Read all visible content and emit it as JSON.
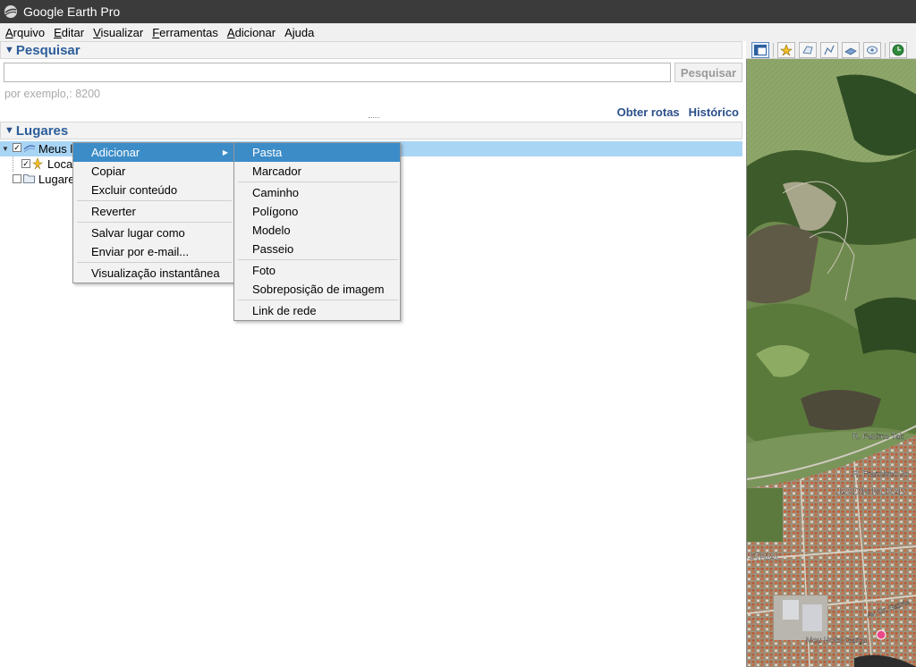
{
  "window": {
    "title": "Google Earth Pro"
  },
  "menubar": {
    "items": [
      "Arquivo",
      "Editar",
      "Visualizar",
      "Ferramentas",
      "Adicionar",
      "Ajuda"
    ],
    "mnemonics": [
      "A",
      "E",
      "V",
      "F",
      "A",
      "j"
    ]
  },
  "search": {
    "header": "Pesquisar",
    "input_value": "",
    "input_placeholder": "",
    "button_label": "Pesquisar",
    "hint": "por exemplo,: 8200",
    "link_directions": "Obter rotas",
    "link_history": "Histórico"
  },
  "places": {
    "header": "Lugares",
    "tree": [
      {
        "label": "Meus lugares",
        "visible_label": "Meus l",
        "checked": true,
        "expanded": true,
        "selected": true,
        "icon": "my-places-icon"
      },
      {
        "label": "Local",
        "checked": true,
        "icon": "placemark-icon"
      },
      {
        "label": "Lugares",
        "checked": false,
        "icon": "folder-icon"
      }
    ]
  },
  "context_menu": {
    "items": [
      {
        "label": "Adicionar",
        "has_submenu": true,
        "active": true
      },
      {
        "label": "Copiar"
      },
      {
        "label": "Excluir conteúdo"
      },
      {
        "separator": true
      },
      {
        "label": "Reverter"
      },
      {
        "separator": true
      },
      {
        "label": "Salvar lugar como"
      },
      {
        "label": "Enviar por e-mail..."
      },
      {
        "separator": true
      },
      {
        "label": "Visualização instantânea"
      }
    ]
  },
  "submenu": {
    "items": [
      {
        "label": "Pasta",
        "active": true
      },
      {
        "label": "Marcador"
      },
      {
        "label": "Caminho"
      },
      {
        "label": "Polígono"
      },
      {
        "label": "Modelo"
      },
      {
        "label": "Passeio"
      },
      {
        "label": "Foto"
      },
      {
        "label": "Sobreposição de imagem"
      },
      {
        "label": "Link de rede"
      }
    ]
  },
  "map": {
    "labels": [
      "R. Fazime Tak",
      "R. Francisco Jo",
      "JARDIM MORAD",
      "STRIAL",
      "Av. Dr. Gabrie",
      "Meu Hotel Garça"
    ]
  },
  "colors": {
    "titlebar": "#3b3b3b",
    "header_text": "#2b5d9a",
    "selection": "#a9d5f5",
    "menu_highlight": "#3c8cc8"
  }
}
